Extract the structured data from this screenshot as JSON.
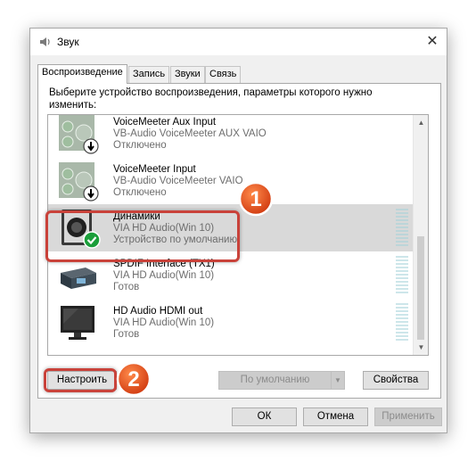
{
  "window": {
    "title": "Звук",
    "close_label": "✕"
  },
  "tabs": [
    "Воспроизведение",
    "Запись",
    "Звуки",
    "Связь"
  ],
  "instruction": "Выберите устройство воспроизведения, параметры которого нужно изменить:",
  "devices": [
    {
      "name": "VoiceMeeter Aux Input",
      "sub": "VB-Audio VoiceMeeter AUX VAIO",
      "status": "Отключено",
      "icon": "voicemeeter-icon"
    },
    {
      "name": "VoiceMeeter Input",
      "sub": "VB-Audio VoiceMeeter VAIO",
      "status": "Отключено",
      "icon": "voicemeeter-icon"
    },
    {
      "name": "Динамики",
      "sub": "VIA HD Audio(Win 10)",
      "status": "Устройство по умолчанию",
      "icon": "speaker-icon",
      "selected": true
    },
    {
      "name": "SPDIF Interface (TX1)",
      "sub": "VIA HD Audio(Win 10)",
      "status": "Готов",
      "icon": "spdif-icon"
    },
    {
      "name": "HD Audio HDMI out",
      "sub": "VIA HD Audio(Win 10)",
      "status": "Готов",
      "icon": "monitor-icon"
    }
  ],
  "buttons": {
    "configure": "Настроить",
    "set_default": "По умолчанию",
    "properties": "Свойства",
    "ok": "ОК",
    "cancel": "Отмена",
    "apply": "Применить"
  },
  "annotations": {
    "badge1": "1",
    "badge2": "2"
  },
  "colors": {
    "highlight": "#c9423a",
    "badge_fill": "#e8552a",
    "selected_row": "#d9d9d9"
  }
}
